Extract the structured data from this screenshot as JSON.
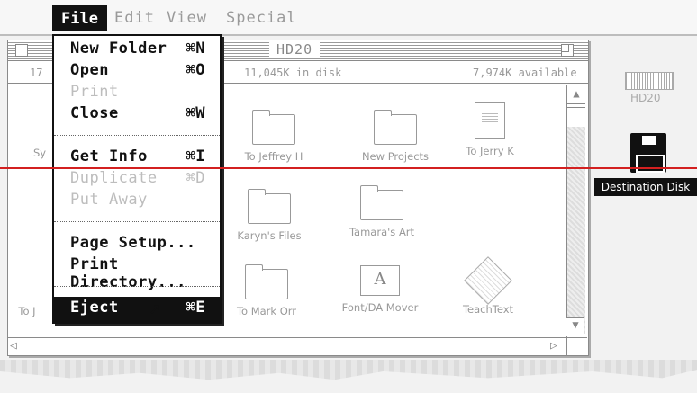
{
  "menubar": {
    "apple_icon": "apple-menu-icon",
    "items": [
      "File",
      "Edit",
      "View",
      "Special"
    ]
  },
  "window": {
    "title": "HD20",
    "info_items": "17",
    "info_disk": "11,045K in disk",
    "info_available": "7,974K available",
    "icons": [
      {
        "label": "Sy",
        "type": "folder-partial"
      },
      {
        "label": "To Jeffrey H",
        "type": "folder"
      },
      {
        "label": "New Projects",
        "type": "folder"
      },
      {
        "label": "To Jerry K",
        "type": "document"
      },
      {
        "label": "Karyn's Files",
        "type": "folder"
      },
      {
        "label": "Tamara's Art",
        "type": "folder"
      },
      {
        "label": "To Mark Orr",
        "type": "folder"
      },
      {
        "label": "Font/DA Mover",
        "type": "application"
      },
      {
        "label": "TeachText",
        "type": "application"
      },
      {
        "label": "To J",
        "type": "folder-partial"
      }
    ]
  },
  "file_menu": {
    "items": [
      {
        "label": "New Folder",
        "shortcut": "⌘N",
        "enabled": true
      },
      {
        "label": "Open",
        "shortcut": "⌘O",
        "enabled": true
      },
      {
        "label": "Print",
        "shortcut": "",
        "enabled": false
      },
      {
        "label": "Close",
        "shortcut": "⌘W",
        "enabled": true
      },
      {
        "label": "Get Info",
        "shortcut": "⌘I",
        "enabled": true
      },
      {
        "label": "Duplicate",
        "shortcut": "⌘D",
        "enabled": false
      },
      {
        "label": "Put Away",
        "shortcut": "",
        "enabled": false
      },
      {
        "label": "Page Setup...",
        "shortcut": "",
        "enabled": true
      },
      {
        "label": "Print Directory...",
        "shortcut": "",
        "enabled": true
      },
      {
        "label": "Eject",
        "shortcut": "⌘E",
        "enabled": true,
        "highlighted": true
      }
    ]
  },
  "desktop": {
    "hd20_label": "HD20",
    "disk_label": "Destination Disk"
  },
  "colors": {
    "menu_highlight": "#111111",
    "annotation_line": "#d32020",
    "disabled_text": "#bdbdbd"
  }
}
